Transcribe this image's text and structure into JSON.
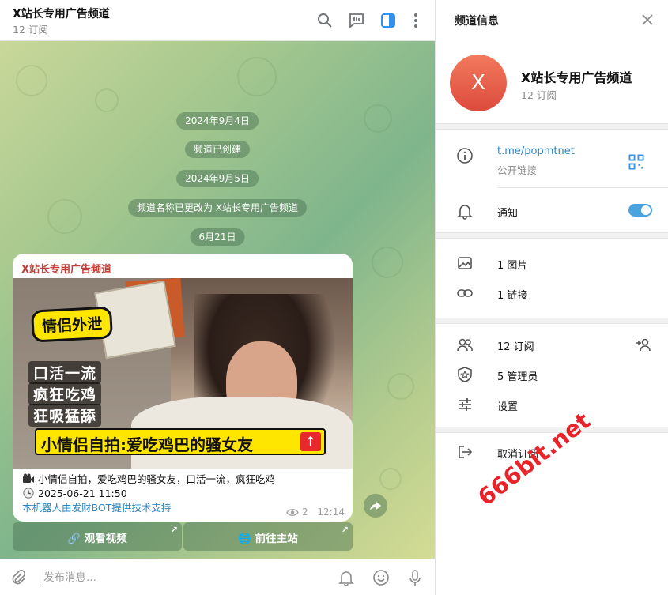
{
  "chat": {
    "title": "X站长专用广告频道",
    "subtitle": "12 订阅",
    "header_icons": [
      "search-icon",
      "chat-feedback-icon",
      "sidebar-toggle-icon",
      "more-vert-icon"
    ]
  },
  "service_messages": [
    "2024年9月4日",
    "频道已创建",
    "2024年9月5日",
    "频道名称已更改为 X站长专用广告频道",
    "6月21日"
  ],
  "post": {
    "author": "X站长专用广告频道",
    "media_text": {
      "tag": "情侣外泄",
      "line1": "口活一流",
      "line2": "疯狂吃鸡",
      "line3": "狂吸猛舔",
      "banner": "小情侣自拍:爱吃鸡巴的骚女友",
      "banner_arrow": "↑"
    },
    "caption_line1": "小情侣自拍，爱吃鸡巴的骚女友，口活一流，疯狂吃鸡",
    "caption_line2": "2025-06-21 11:50",
    "caption_link": "本机器人由发财BOT提供技术支持",
    "views": "2",
    "time": "12:14"
  },
  "inline_buttons": [
    {
      "icon": "link-icon",
      "label": "观看视频",
      "corner": "↗"
    },
    {
      "icon": "globe-icon",
      "label": "前往主站",
      "corner": "↗"
    }
  ],
  "composer": {
    "placeholder": "发布消息..."
  },
  "info": {
    "title": "频道信息",
    "avatar_letter": "X",
    "name": "X站长专用广告频道",
    "subscribers": "12 订阅",
    "link": "t.me/popmtnet",
    "link_caption": "公开链接",
    "notify_label": "通知",
    "notify_on": true,
    "photos": "1 图片",
    "links": "1 链接",
    "subs_row": "12 订阅",
    "admins": "5 管理员",
    "settings": "设置",
    "leave": "取消订阅"
  },
  "watermark": "666bit.net",
  "colors": {
    "accent": "#4aa3df",
    "author": "#c0403a",
    "avatar": "#e85a45",
    "watermark": "#e8232a"
  }
}
